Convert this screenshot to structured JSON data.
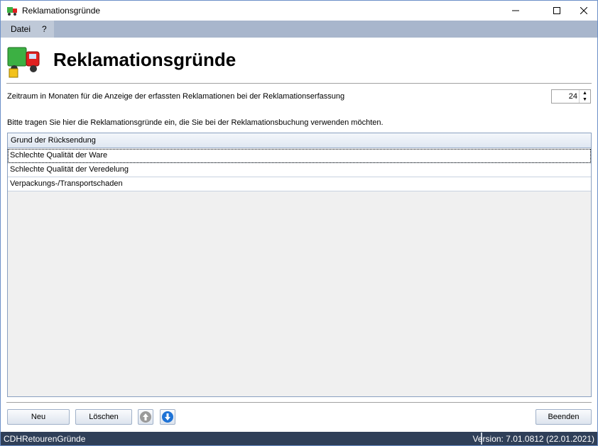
{
  "window": {
    "title": "Reklamationsgründe",
    "controls": {
      "minimize": "—",
      "maximize": "☐",
      "close": "✕"
    }
  },
  "menu": {
    "items": [
      "Datei",
      "?"
    ]
  },
  "header": {
    "title": "Reklamationsgründe"
  },
  "period": {
    "label": "Zeitraum in Monaten für die Anzeige der erfassten Reklamationen bei der Reklamationserfassung",
    "value": "24"
  },
  "instruction": "Bitte tragen Sie hier die Reklamationsgründe ein, die Sie bei der Reklamationsbuchung verwenden möchten.",
  "table": {
    "column_header": "Grund der Rücksendung",
    "rows": [
      "Schlechte Qualität der Ware",
      "Schlechte Qualität der Veredelung",
      "Verpackungs-/Transportschaden"
    ]
  },
  "buttons": {
    "new": "Neu",
    "delete": "Löschen",
    "close": "Beenden"
  },
  "statusbar": {
    "left": "CDHRetourenGründe",
    "right": "Version: 7.01.0812 (22.01.2021)"
  },
  "colors": {
    "menubar": "#a8b6cc",
    "statusbar": "#2f3f58",
    "grid_border": "#8aa0c0"
  }
}
